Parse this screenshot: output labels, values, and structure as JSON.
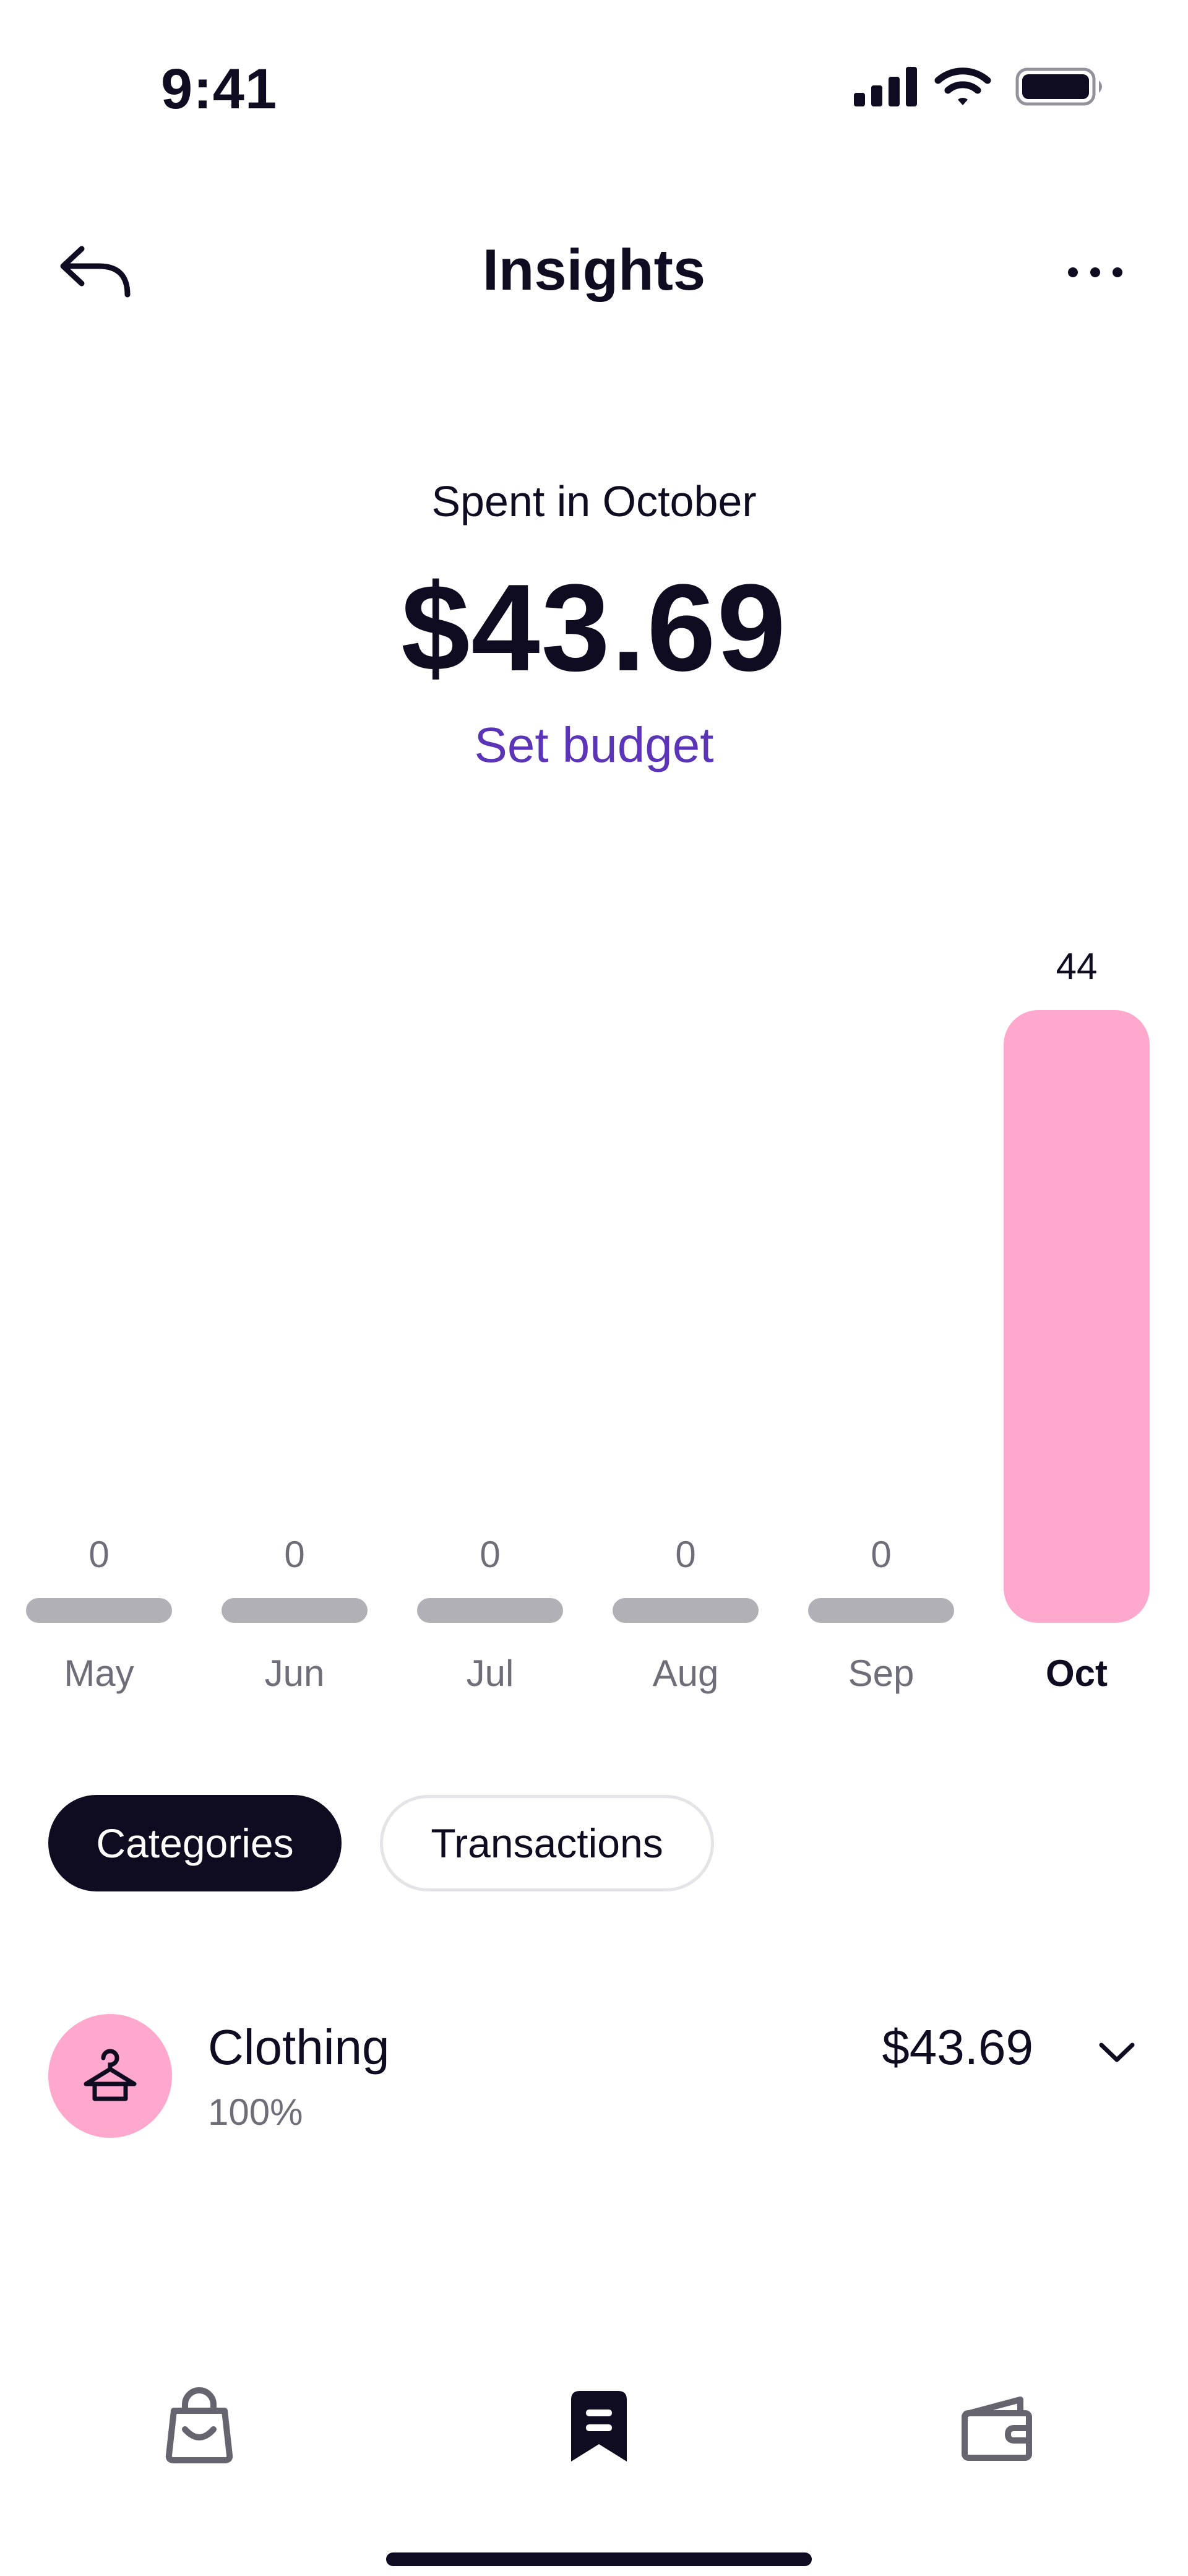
{
  "status_bar": {
    "time": "9:41",
    "icons": [
      "cellular-signal-icon",
      "wifi-icon",
      "battery-icon"
    ]
  },
  "nav": {
    "title": "Insights",
    "back_icon": "back-arrow-icon",
    "more_icon": "more-dots-icon"
  },
  "summary": {
    "label": "Spent in October",
    "amount": "$43.69",
    "budget_link": "Set budget"
  },
  "chart_data": {
    "type": "bar",
    "categories": [
      "May",
      "Jun",
      "Jul",
      "Aug",
      "Sep",
      "Oct"
    ],
    "values": [
      0,
      0,
      0,
      0,
      0,
      44
    ],
    "data_labels": [
      "0",
      "0",
      "0",
      "0",
      "0",
      "44"
    ],
    "selected": "Oct",
    "ylim": [
      0,
      44
    ],
    "grid": false,
    "colors": {
      "bar_active": "#ffa8ce",
      "bar_inactive": "#b1b0b7",
      "label": "#6e6d78",
      "label_active": "#0f0c22"
    }
  },
  "segments": {
    "categories": "Categories",
    "transactions": "Transactions",
    "active": "Categories"
  },
  "categories": [
    {
      "name": "Clothing",
      "percent": "100%",
      "amount": "$43.69",
      "icon": "hanger-icon",
      "color": "#ffa8ce"
    }
  ],
  "tab_bar": {
    "items": [
      {
        "icon": "shopping-bag-icon",
        "active": false
      },
      {
        "icon": "receipt-icon",
        "active": true
      },
      {
        "icon": "wallet-icon",
        "active": false
      }
    ]
  },
  "colors": {
    "text_primary": "#0f0c22",
    "text_secondary": "#6e6d78",
    "accent": "#5b34b8",
    "pink": "#ffa8ce",
    "inactive_bar": "#b1b0b7",
    "inactive_tab_icon": "#66656f"
  }
}
